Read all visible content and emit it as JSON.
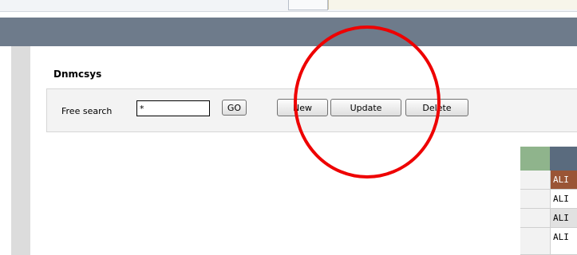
{
  "header": {
    "title": "Dnmcsys"
  },
  "toolbar": {
    "search_label": "Free search",
    "search_value": "*",
    "go_label": "GO",
    "new_label": "New",
    "update_label": "Update",
    "delete_label": "Delete"
  },
  "grid": {
    "rows": [
      {
        "value": "ALI"
      },
      {
        "value": "ALI"
      },
      {
        "value": "ALI"
      },
      {
        "value": "ALI"
      }
    ]
  },
  "colors": {
    "header_band": "#6e7b8b",
    "selected_row": "#9a5536",
    "grid_header_green": "#8fb48c",
    "grid_header_blue": "#5a6b7e",
    "annotation": "#ee0000"
  }
}
